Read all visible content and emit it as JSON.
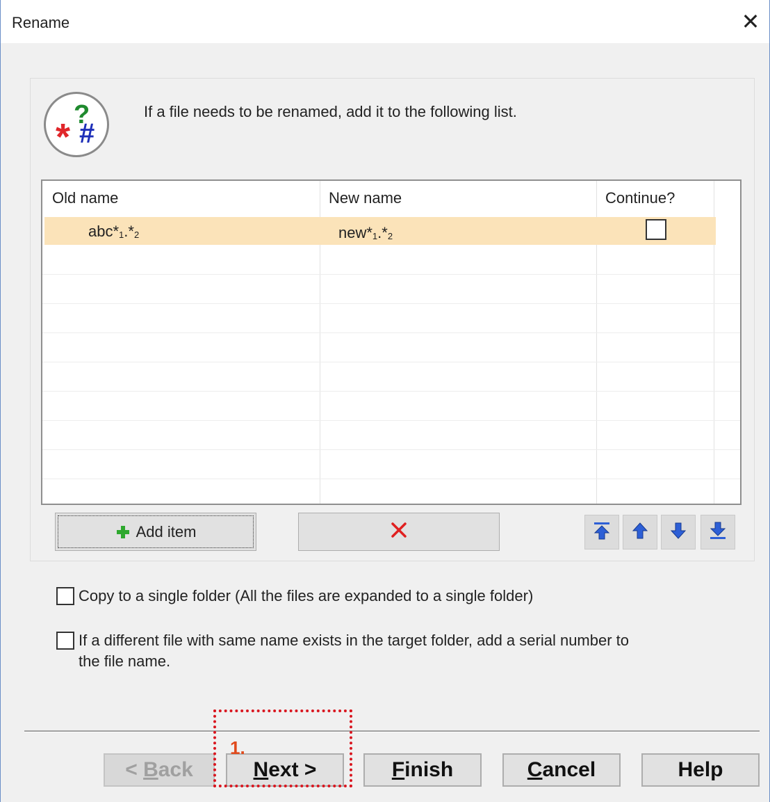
{
  "window": {
    "title": "Rename",
    "close_glyph": "✕"
  },
  "description": "If a file needs to be renamed, add it to the following list.",
  "logo": {
    "icon": "rename-wildcard-logo-icon"
  },
  "table": {
    "headers": {
      "old": "Old name",
      "new": "New name",
      "continue": "Continue?"
    },
    "rows": [
      {
        "old_base": "abc*",
        "old_s1": "1",
        "old_mid": ".*",
        "old_s2": "2",
        "new_base": "new*",
        "new_s1": "1",
        "new_mid": ".*",
        "new_s2": "2",
        "continue": false,
        "selected": true
      }
    ]
  },
  "toolbar": {
    "add_label": "Add item",
    "add_icon": "plus-icon",
    "delete_icon": "delete-x-icon",
    "move_icons": [
      "move-top-icon",
      "move-up-icon",
      "move-down-icon",
      "move-bottom-icon"
    ]
  },
  "options": {
    "single_folder": {
      "label": "Copy to a single folder (All the files are expanded to a single folder)",
      "checked": false
    },
    "serial_number": {
      "label_line1": "If a different file with same name exists in the target folder, add a serial number to",
      "label_line2": "the file name.",
      "checked": false
    }
  },
  "footer": {
    "back": {
      "prefix": "< ",
      "accel": "B",
      "rest": "ack",
      "enabled": false
    },
    "next": {
      "accel": "N",
      "rest": "ext >"
    },
    "finish": {
      "accel": "F",
      "rest": "inish"
    },
    "cancel": {
      "accel": "C",
      "rest": "ancel"
    },
    "help": {
      "label": "Help"
    }
  },
  "annotation": {
    "label": "1.",
    "color": "#d9161f"
  },
  "colors": {
    "selected_row": "#fbe3b9",
    "plus_green": "#2ea82e",
    "delete_red": "#e02020",
    "arrow_blue": "#2d5fd6"
  }
}
